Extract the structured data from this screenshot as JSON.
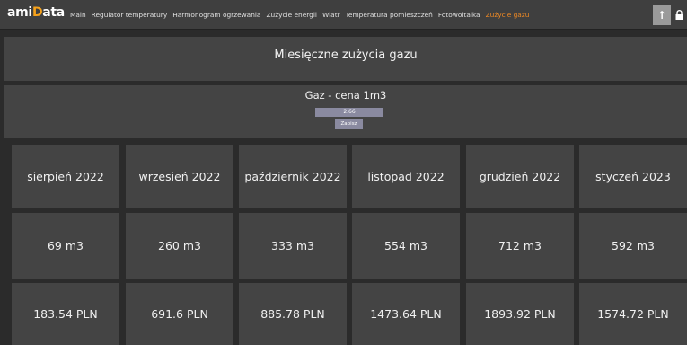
{
  "logo": {
    "text_a": "ami",
    "text_d": "D",
    "text_b": "ata"
  },
  "nav": {
    "items": [
      {
        "label": "Main"
      },
      {
        "label": "Regulator temperatury"
      },
      {
        "label": "Harmonogram ogrzewania"
      },
      {
        "label": "Zużycie energii"
      },
      {
        "label": "Wiatr"
      },
      {
        "label": "Temperatura pomieszczeń"
      },
      {
        "label": "Fotowoltaika"
      },
      {
        "label": "Zużycie gazu",
        "active": true
      }
    ],
    "up_icon": "↑",
    "lock_icon": "🔒"
  },
  "title": "Miesięczne zużycia gazu",
  "price": {
    "label": "Gaz - cena 1m3",
    "value": "2.66",
    "save_label": "Zapisz"
  },
  "months": [
    "sierpień 2022",
    "wrzesień 2022",
    "październik 2022",
    "listopad 2022",
    "grudzień 2022",
    "styczeń 2023"
  ],
  "usage": [
    "69 m3",
    "260 m3",
    "333 m3",
    "554 m3",
    "712 m3",
    "592 m3"
  ],
  "costs": [
    "183.54 PLN",
    "691.6 PLN",
    "885.78 PLN",
    "1473.64 PLN",
    "1893.92 PLN",
    "1574.72 PLN"
  ],
  "colors": {
    "accent": "#f08a24",
    "panel": "#444444",
    "background": "#2b2b2b",
    "input": "#8a8aa0"
  }
}
